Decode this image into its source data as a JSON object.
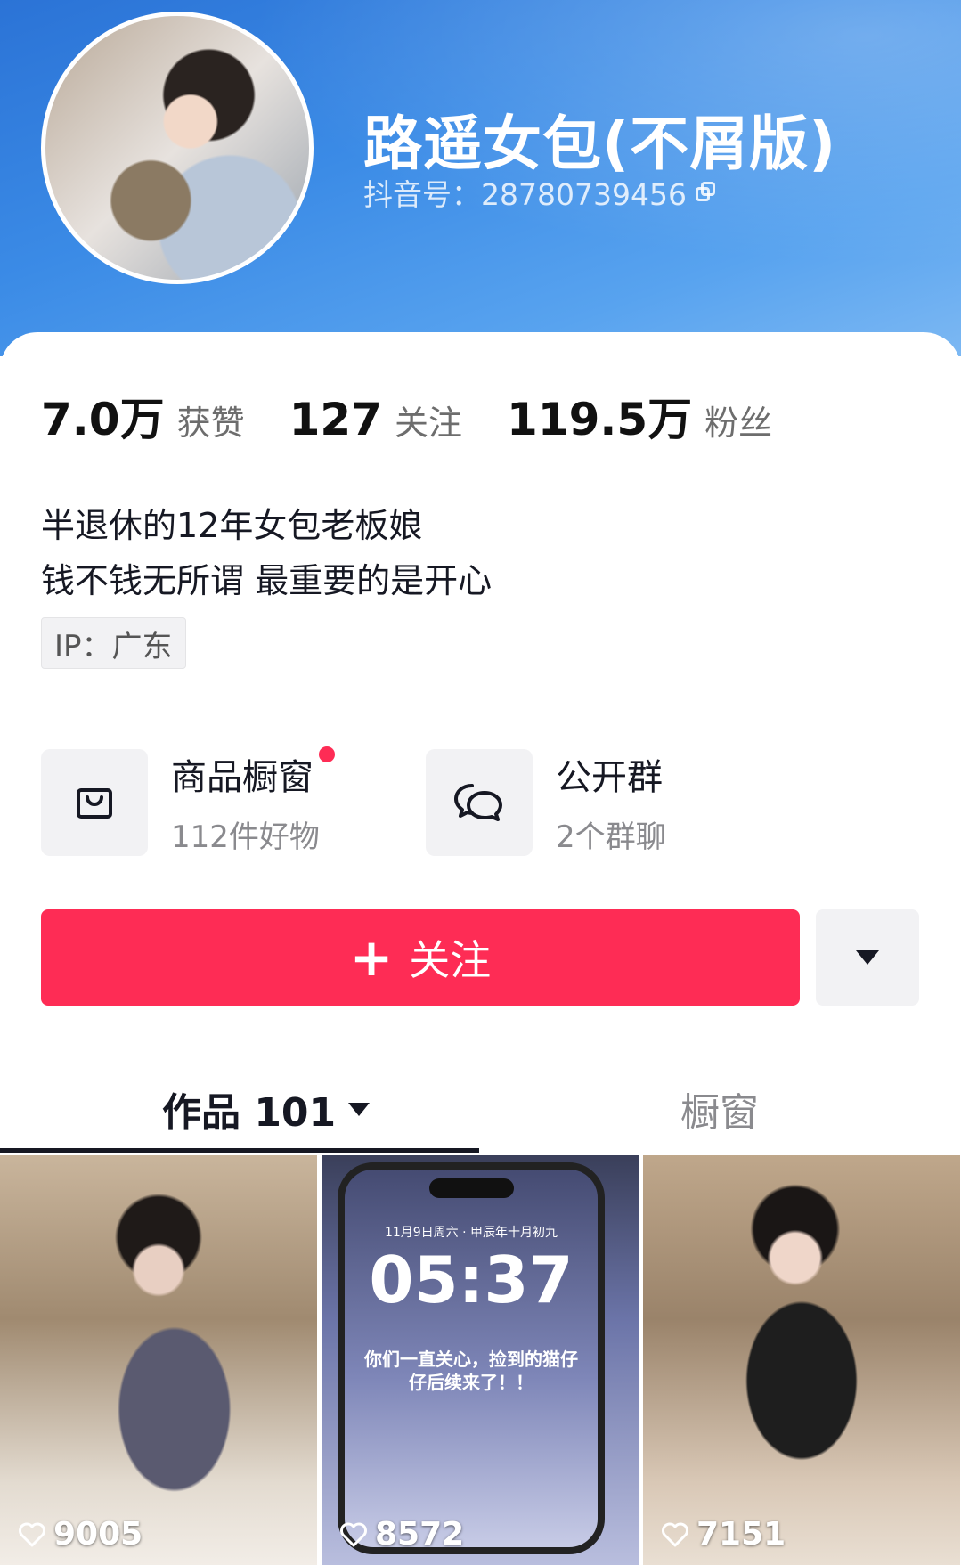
{
  "profile": {
    "name": "路遥女包(不屑版)",
    "douyin_id": "抖音号：28780739456",
    "avatar_icon": "avatar-photo"
  },
  "stats": [
    {
      "value": "7.0万",
      "label": "获赞"
    },
    {
      "value": "127",
      "label": "关注"
    },
    {
      "value": "119.5万",
      "label": "粉丝"
    }
  ],
  "bio": {
    "line1": "半退休的12年女包老板娘",
    "line2": "钱不钱无所谓 最重要的是开心",
    "ip": "IP：广东"
  },
  "shortcuts": {
    "shop": {
      "title": "商品橱窗",
      "subtitle": "112件好物",
      "icon": "shopping-bag-icon",
      "has_dot": true
    },
    "group": {
      "title": "公开群",
      "subtitle": "2个群聊",
      "icon": "chat-bubbles-icon"
    }
  },
  "actions": {
    "follow_label": "关注",
    "follow_color": "#fe2c55"
  },
  "tabs": {
    "works": "作品 101",
    "shop": "橱窗"
  },
  "videos": [
    {
      "likes": "9005"
    },
    {
      "likes": "8572",
      "lock_date": "11月9日周六 · 甲辰年十月初九",
      "lock_time": "05:37",
      "caption": "你们一直关心，捡到的猫仔仔后续来了！！"
    },
    {
      "likes": "7151"
    }
  ]
}
